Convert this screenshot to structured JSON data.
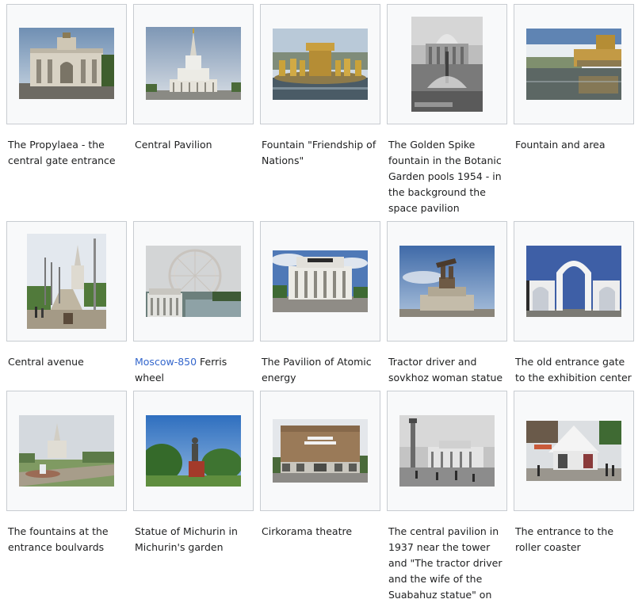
{
  "gallery": {
    "items": [
      {
        "image": "propylaea-gate-photo",
        "caption": "The Propylaea - the central gate entrance"
      },
      {
        "image": "central-pavilion-photo",
        "caption": "Central Pavilion"
      },
      {
        "image": "friendship-fountain-photo",
        "caption": "Fountain \"Friendship of Nations\""
      },
      {
        "image": "golden-spike-fountain-photo",
        "caption": "The Golden Spike fountain in the Botanic Garden pools 1954 - in the background the space pavilion"
      },
      {
        "image": "fountain-area-photo",
        "caption": "Fountain and area"
      },
      {
        "image": "central-avenue-photo",
        "caption": "Central avenue"
      },
      {
        "image": "ferris-wheel-photo",
        "caption_link": "Moscow-850",
        "caption_rest": " Ferris wheel"
      },
      {
        "image": "atomic-pavilion-photo",
        "caption": "The Pavilion of Atomic energy"
      },
      {
        "image": "tractor-driver-statue-photo",
        "caption": "Tractor driver and sovkhoz woman statue"
      },
      {
        "image": "old-entrance-gate-photo",
        "caption": "The old entrance gate to the exhibition center"
      },
      {
        "image": "boulevard-fountains-photo",
        "caption": "The fountains at the entrance boulvards"
      },
      {
        "image": "michurin-statue-photo",
        "caption": "Statue of Michurin in Michurin's garden"
      },
      {
        "image": "cirkorama-theatre-photo",
        "caption": "Cirkorama theatre"
      },
      {
        "image": "central-pavilion-1937-photo",
        "caption": "The central pavilion in 1937 near the tower and \"The tractor driver and the wife of the Suabahuz statue\" on"
      },
      {
        "image": "roller-coaster-entrance-photo",
        "caption": "The entrance to the roller coaster"
      }
    ]
  }
}
